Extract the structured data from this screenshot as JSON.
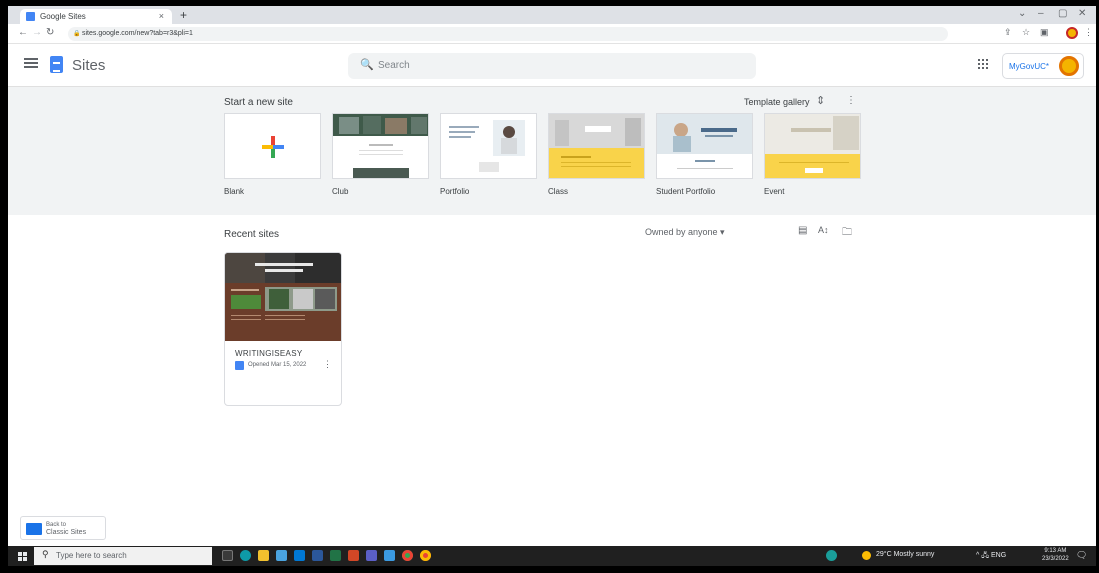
{
  "browser": {
    "tab_title": "Google Sites",
    "tab_close": "×",
    "new_tab": "+",
    "url": "sites.google.com/new?tab=r3&pli=1",
    "window_controls": [
      "⌄",
      "–",
      "▢",
      "✕"
    ]
  },
  "header": {
    "app_title": "Sites",
    "search_placeholder": "Search",
    "account_label": "MyGovUC*"
  },
  "gallery": {
    "start_label": "Start a new site",
    "template_gallery_label": "Template gallery",
    "templates": [
      {
        "name": "Blank"
      },
      {
        "name": "Club"
      },
      {
        "name": "Portfolio"
      },
      {
        "name": "Class"
      },
      {
        "name": "Student Portfolio"
      },
      {
        "name": "Event"
      }
    ]
  },
  "recent": {
    "label": "Recent sites",
    "owner_filter": "Owned by anyone ▾",
    "sites": [
      {
        "title": "WRITINGISEASY",
        "opened": "Opened Mar 15, 2022"
      }
    ]
  },
  "classic_sites": {
    "line1": "Back to",
    "line2": "Classic Sites"
  },
  "taskbar": {
    "search_placeholder": "Type here to search",
    "weather": "29°C  Mostly sunny",
    "tray": "^ 🖧 ENG",
    "time": "9:13 AM",
    "date": "23/3/2022"
  },
  "colors": {
    "accent": "#1a73e8",
    "gallery_bg": "#f1f3f4",
    "taskbar_bg": "#202020"
  }
}
